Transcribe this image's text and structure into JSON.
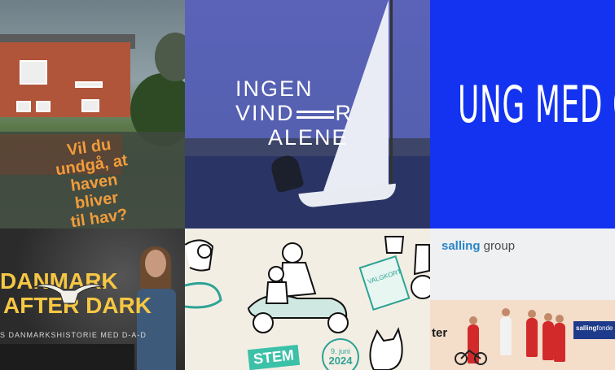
{
  "tiles": [
    {
      "id": "tile-garden-flood",
      "overlay_text_lines": [
        "Vil du",
        "undgå, at",
        "haven",
        "bliver",
        "til hav?"
      ]
    },
    {
      "id": "tile-sailing",
      "headline_lines": [
        "INGEN",
        "VIND",
        "R",
        "ALENE"
      ]
    },
    {
      "id": "tile-ung-med-os",
      "headline": "UNG MED OS"
    },
    {
      "id": "tile-danmark-after-dark",
      "title_lines": [
        "DANMARK",
        "AFTER DARK"
      ],
      "subline": "S DANMARKSHISTORIE MED D-A-D"
    },
    {
      "id": "tile-stem-illustration",
      "stem_label": "STEM",
      "date_line1": "9. juni",
      "date_line2": "2024",
      "stamp_text": "VALGKORT"
    },
    {
      "id": "tile-salling-group",
      "logo_bold": "salling",
      "logo_rest": " group",
      "promo_text": "ter",
      "board_bold": "salling",
      "board_rest": "fonde"
    }
  ],
  "colors": {
    "blue_tile": "#1333f0",
    "sailing_bg": "#5a63b8",
    "orange_text": "#f29c3b",
    "gold_text": "#f6c743",
    "teal": "#2da394",
    "salling_blue": "#2a86c8"
  }
}
